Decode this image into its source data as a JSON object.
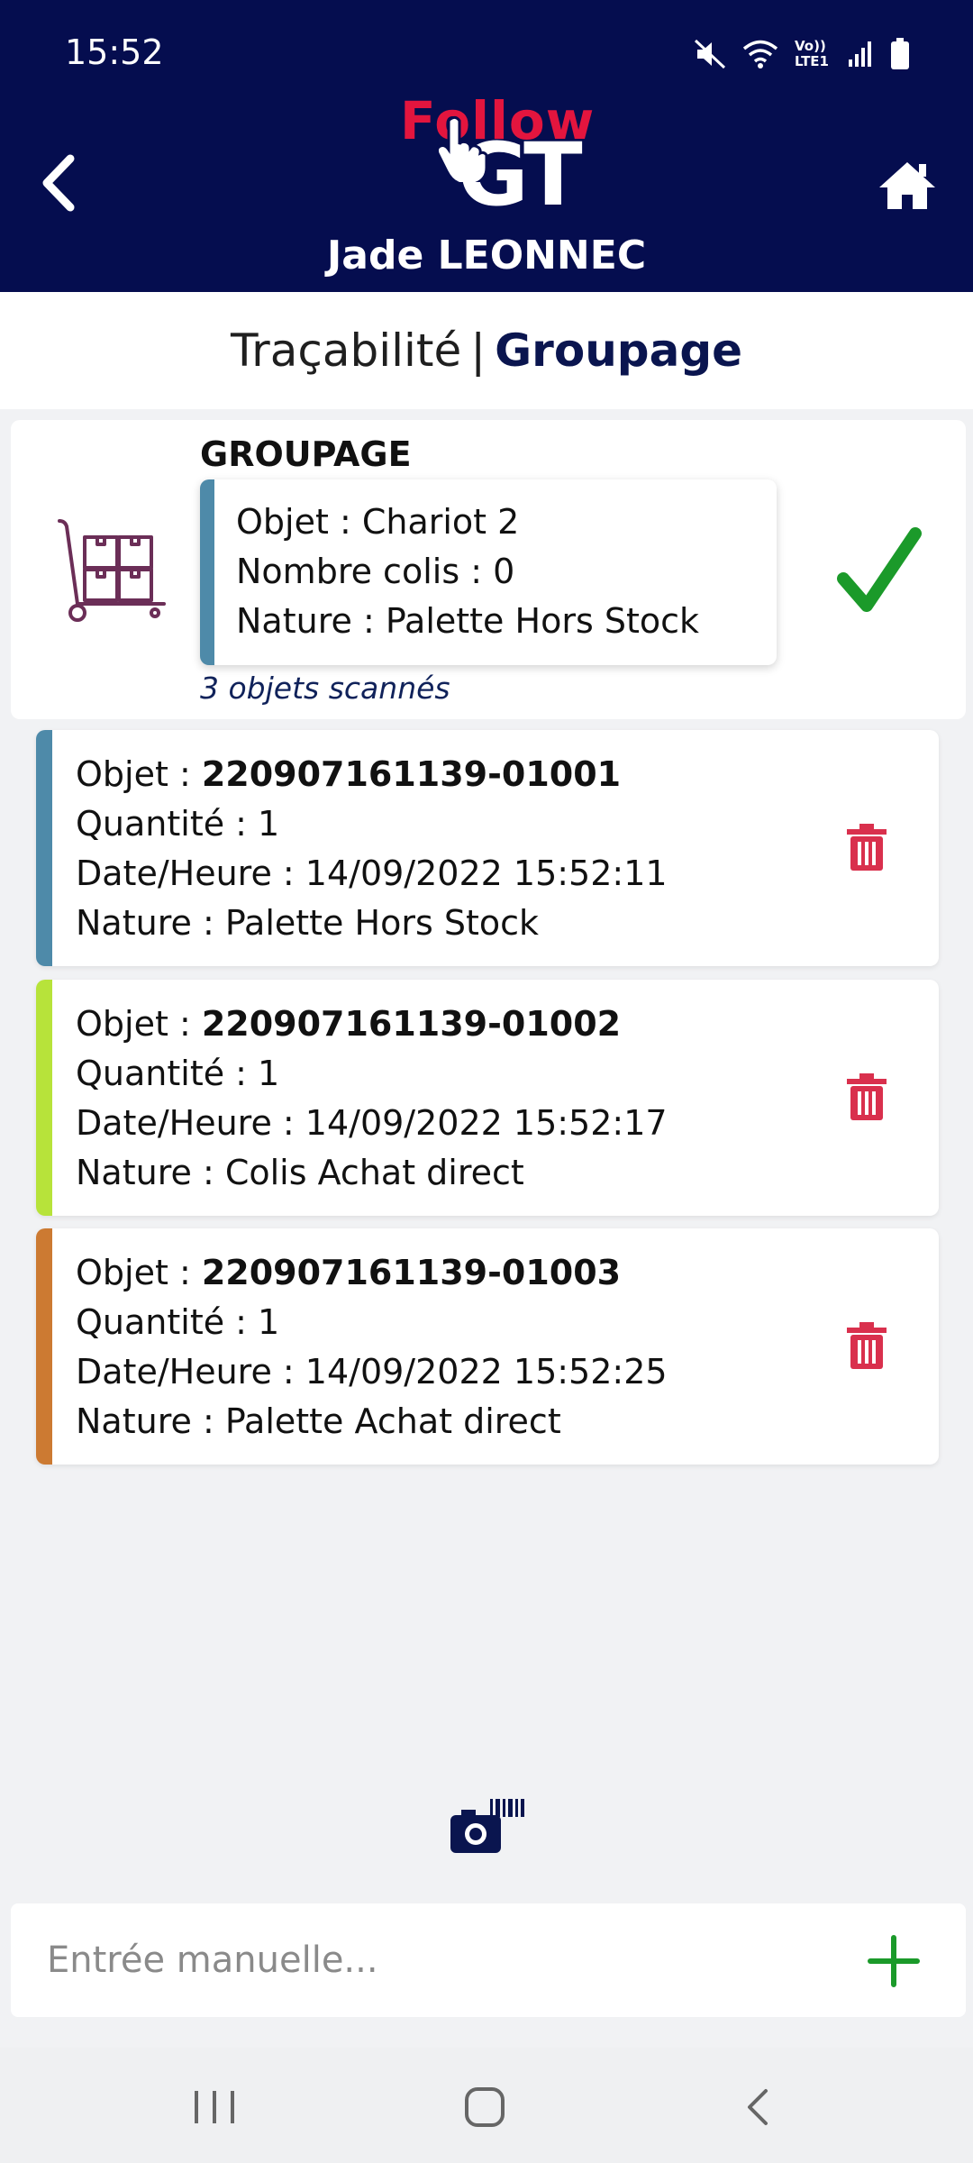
{
  "status_bar": {
    "time": "15:52",
    "icons": [
      "mute-icon",
      "wifi-icon",
      "volte-icon",
      "signal-icon",
      "battery-icon"
    ],
    "volte_text": "Vo)) LTE1"
  },
  "header": {
    "logo_top": "Follow",
    "logo_bottom": "GT",
    "user_name": "Jade LEONNEC",
    "background": "#050d4f"
  },
  "titlebar": {
    "left": "Traçabilité",
    "separator": "|",
    "right": "Groupage"
  },
  "groupage": {
    "title": "GROUPAGE",
    "objet": "Objet : Chariot 2",
    "colis": "Nombre colis : 0",
    "nature": "Nature : Palette Hors Stock",
    "scanned": "3 objets scannés",
    "accent": "#4e8aa9",
    "check_color": "#1b9a2a"
  },
  "items": [
    {
      "objet_label": "Objet : ",
      "objet_value": "220907161139-01001",
      "quantite": "Quantité : 1",
      "date": "Date/Heure : 14/09/2022 15:52:11",
      "nature": "Nature : Palette Hors Stock",
      "color": "#4e8aa9"
    },
    {
      "objet_label": "Objet : ",
      "objet_value": "220907161139-01002",
      "quantite": "Quantité : 1",
      "date": "Date/Heure : 14/09/2022 15:52:17",
      "nature": "Nature : Colis Achat direct",
      "color": "#b7e33a"
    },
    {
      "objet_label": "Objet : ",
      "objet_value": "220907161139-01003",
      "quantite": "Quantité : 1",
      "date": "Date/Heure : 14/09/2022 15:52:25",
      "nature": "Nature : Palette Achat direct",
      "color": "#cc7a32"
    }
  ],
  "manual_entry": {
    "placeholder": "Entrée manuelle...",
    "value": ""
  },
  "colors": {
    "trash": "#d9304d",
    "plus": "#1b9a2a",
    "brand_red": "#e3153e"
  }
}
